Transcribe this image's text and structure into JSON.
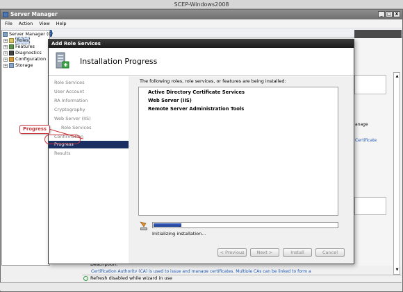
{
  "vm_title": "SCEP-Windows2008",
  "server_manager": {
    "title": "Server Manager",
    "window_buttons": [
      "_",
      "□",
      "X"
    ]
  },
  "menu": [
    "File",
    "Action",
    "View",
    "Help"
  ],
  "tree": [
    {
      "label": "Server Manager (C/",
      "icon": "server-icon",
      "expander": ""
    },
    {
      "label": "Roles",
      "icon": "roles-icon",
      "expander": "+"
    },
    {
      "label": "Features",
      "icon": "features-icon",
      "expander": "+"
    },
    {
      "label": "Diagnostics",
      "icon": "diagnostics-icon",
      "expander": "+"
    },
    {
      "label": "Configuration",
      "icon": "configuration-icon",
      "expander": "+"
    },
    {
      "label": "Storage",
      "icon": "storage-icon",
      "expander": "+"
    }
  ],
  "background": {
    "right_text_1": "anage",
    "right_link": "Certificate",
    "description_label": "Description:",
    "description_text": "Certification Authority (CA) is used to issue and manage certificates. Multiple CAs can be linked to form a",
    "status": "Refresh disabled while wizard in use"
  },
  "wizard": {
    "title": "Add Role Services",
    "heading": "Installation Progress",
    "nav": [
      {
        "label": "Role Services",
        "sub": false,
        "active": false
      },
      {
        "label": "User Account",
        "sub": false,
        "active": false
      },
      {
        "label": "RA Information",
        "sub": false,
        "active": false
      },
      {
        "label": "Cryptography",
        "sub": false,
        "active": false
      },
      {
        "label": "Web Server (IIS)",
        "sub": false,
        "active": false
      },
      {
        "label": "Role Services",
        "sub": true,
        "active": false
      },
      {
        "label": "Confirmation",
        "sub": false,
        "active": false
      },
      {
        "label": "Progress",
        "sub": false,
        "active": true
      },
      {
        "label": "Results",
        "sub": false,
        "active": false
      }
    ],
    "lead_text": "The following roles, role services, or features are being installed:",
    "items": [
      "Active Directory Certificate Services",
      "Web Server (IIS)",
      "Remote Server Administration Tools"
    ],
    "progress_fraction": 0.15,
    "status_text": "Initializing installation...",
    "buttons": {
      "previous": "< Previous",
      "next": "Next >",
      "install": "Install",
      "cancel": "Cancel"
    }
  },
  "callout_label": "Progress",
  "colors": {
    "nav_active": "#1b2f63",
    "callout": "#c9353a",
    "progress_fill": "#2a4aa8"
  }
}
